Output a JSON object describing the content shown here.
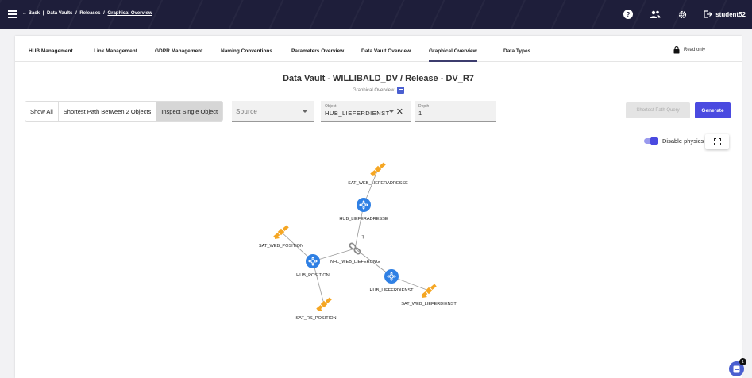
{
  "header": {
    "back_label": "← Back",
    "crumbs": [
      "Data Vaults",
      "Releases"
    ],
    "current_crumb": "Graphical Overview",
    "username": "student52"
  },
  "tabs": [
    {
      "label": "HUB Management"
    },
    {
      "label": "Link Management"
    },
    {
      "label": "GDPR Management"
    },
    {
      "label": "Naming Conventions"
    },
    {
      "label": "Parameters Overview"
    },
    {
      "label": "Data Vault Overview"
    },
    {
      "label": "Graphical Overview",
      "active": true
    },
    {
      "label": "Data Types"
    }
  ],
  "read_only_label": "Read only",
  "page": {
    "title": "Data Vault - WILLIBALD_DV / Release - DV_R7",
    "subtitle": "Graphical Overview"
  },
  "mode_buttons": [
    {
      "label": "Show All"
    },
    {
      "label": "Shortest Path Between 2 Objects"
    },
    {
      "label": "Inspect Single Object",
      "active": true
    }
  ],
  "source_field": {
    "placeholder": "Source"
  },
  "object_field": {
    "label": "Object",
    "value": "HUB_LIEFERDIENST"
  },
  "depth_field": {
    "label": "Depth",
    "value": "1"
  },
  "shortest_path_button": "Shortest Path Query",
  "generate_button": "Generate",
  "physics_toggle": {
    "label": "Disable physics",
    "on": true
  },
  "chat_badge": "1",
  "colors": {
    "hub": "#2f80e4",
    "satellite": "#f5a623",
    "link": "#8a8a8a",
    "accent": "#4a4ae0",
    "topbar": "#1e1e3a"
  },
  "graph": {
    "nodes": [
      {
        "id": "sat_lieferadresse",
        "kind": "satellite",
        "label": "SAT_WEB_LIEFERADRESSE"
      },
      {
        "id": "hub_lieferadresse",
        "kind": "hub",
        "label": "HUB_LIEFERADRESSE"
      },
      {
        "id": "nhl_lieferung",
        "kind": "link",
        "label": "NHL_WEB_LIEFERUNG"
      },
      {
        "id": "sat_position",
        "kind": "satellite",
        "label": "SAT_WEB_POSITION"
      },
      {
        "id": "hub_position",
        "kind": "hub",
        "label": "HUB_POSITION"
      },
      {
        "id": "hub_lieferdienst",
        "kind": "hub",
        "label": "HUB_LIEFERDIENST"
      },
      {
        "id": "sat_lieferdienst",
        "kind": "satellite",
        "label": "SAT_WEB_LIEFERDIENST"
      },
      {
        "id": "sat_rs_position",
        "kind": "satellite",
        "label": "SAT_RS_POSITION"
      }
    ],
    "edges": [
      {
        "from": "sat_lieferadresse",
        "to": "hub_lieferadresse"
      },
      {
        "from": "hub_lieferadresse",
        "to": "nhl_lieferung",
        "label": "T"
      },
      {
        "from": "nhl_lieferung",
        "to": "hub_position"
      },
      {
        "from": "nhl_lieferung",
        "to": "hub_lieferdienst"
      },
      {
        "from": "sat_position",
        "to": "hub_position"
      },
      {
        "from": "hub_position",
        "to": "sat_rs_position"
      },
      {
        "from": "hub_lieferdienst",
        "to": "sat_lieferdienst"
      }
    ]
  }
}
